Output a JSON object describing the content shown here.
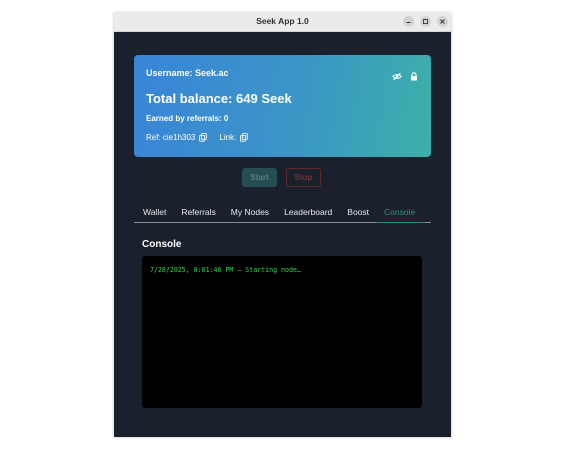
{
  "window": {
    "title": "Seek App 1.0"
  },
  "account": {
    "username": "Username: Seek.ac",
    "balance": "Total balance: 649 Seek",
    "earned": "Earned by referrals: 0",
    "ref_label": "Ref: cie1h303",
    "link_label": "Link:"
  },
  "controls": {
    "start_label": "Start",
    "stop_label": "Stop"
  },
  "tabs": [
    {
      "label": "Wallet"
    },
    {
      "label": "Referrals"
    },
    {
      "label": "My Nodes"
    },
    {
      "label": "Leaderboard"
    },
    {
      "label": "Boost"
    },
    {
      "label": "Console",
      "active": true
    }
  ],
  "console": {
    "title": "Console",
    "lines": [
      "7/28/2025, 8:01:46 PM — Starting node…"
    ]
  },
  "icons": {
    "visibility": "eye-off-icon",
    "lock": "lock-icon",
    "copy": "copy-icon"
  },
  "colors": {
    "accent": "#2f8d83",
    "card_start": "#3a84d8",
    "card_end": "#3cb0a8",
    "console_text": "#39d353",
    "background": "#1b212c"
  }
}
